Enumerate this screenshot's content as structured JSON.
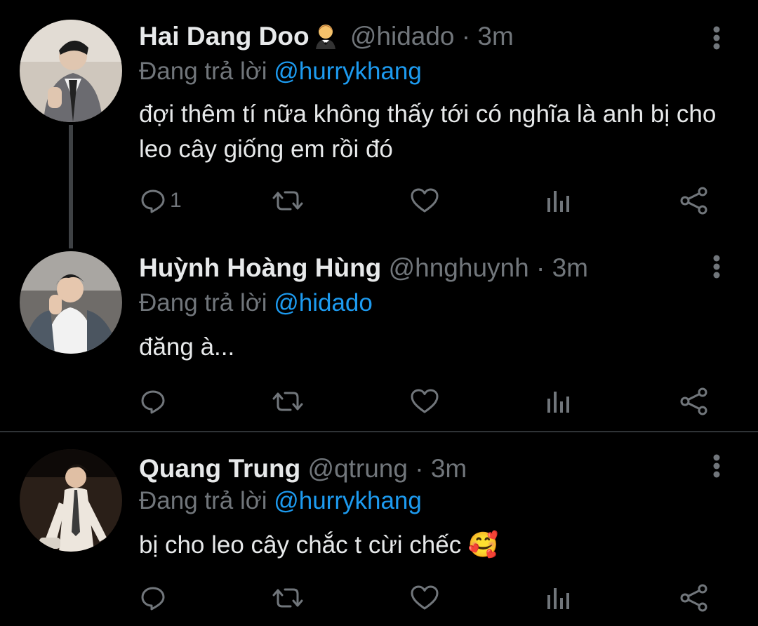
{
  "tweets": [
    {
      "name": "Hai Dang Doo",
      "handle": "@hidado",
      "sep": "·",
      "time": "3m",
      "reply_prefix": "Đang trả lời",
      "reply_to": "@hurrykhang",
      "text": "đợi thêm tí nữa không thấy tới có nghĩa là anh bị cho leo cây giống em rồi đó",
      "reply_count": "1",
      "avatar_icon": "profile-photo"
    },
    {
      "name": "Huỳnh Hoàng Hùng",
      "handle": "@hnghuynh",
      "sep": "·",
      "time": "3m",
      "reply_prefix": "Đang trả lời",
      "reply_to": "@hidado",
      "text": "đăng à...",
      "reply_count": "",
      "avatar_icon": "profile-photo"
    },
    {
      "name": "Quang Trung",
      "handle": "@qtrung",
      "sep": "·",
      "time": "3m",
      "reply_prefix": "Đang trả lời",
      "reply_to": "@hurrykhang",
      "text": "bị cho leo cây chắc t cừi chếc 🥰",
      "reply_count": "",
      "avatar_icon": "profile-photo"
    }
  ],
  "colors": {
    "background": "#000000",
    "text": "#e7e9ea",
    "secondary": "#71767b",
    "link": "#1d9bf0",
    "divider": "#2f3336"
  }
}
